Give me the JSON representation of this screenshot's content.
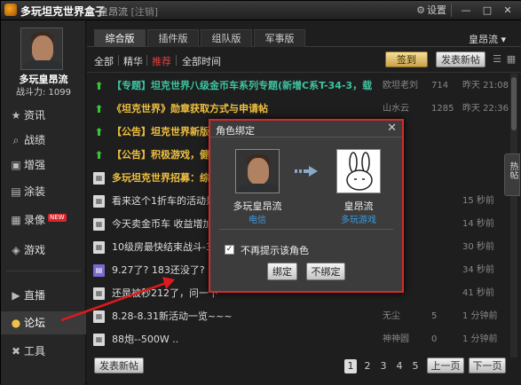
{
  "titlebar": {
    "app_title": "多玩坦克世界盒子",
    "user": "皇昂流",
    "status": "[注销]",
    "settings_label": "设置",
    "minimize": "—",
    "maximize": "□",
    "close": "✕"
  },
  "profile": {
    "username": "多玩皇昂流",
    "power_label": "战斗力: 1099"
  },
  "sidebar": {
    "items": [
      {
        "label": "资讯",
        "icon": "star-icon",
        "glyph": "★"
      },
      {
        "label": "战绩",
        "icon": "search-icon",
        "glyph": "⌕"
      },
      {
        "label": "增强",
        "icon": "box-icon",
        "glyph": "▣"
      },
      {
        "label": "涂装",
        "icon": "paint-icon",
        "glyph": "▤"
      },
      {
        "label": "录像",
        "icon": "video-icon",
        "glyph": "▦",
        "badge": "NEW"
      },
      {
        "label": "游戏",
        "icon": "gamepad-icon",
        "glyph": "◈"
      },
      {
        "label": "直播",
        "icon": "play-icon",
        "glyph": "▶"
      },
      {
        "label": "论坛",
        "icon": "chat-icon",
        "glyph": "●"
      },
      {
        "label": "工具",
        "icon": "wrench-icon",
        "glyph": "✖"
      }
    ]
  },
  "tabs": [
    "综合版",
    "插件版",
    "组队版",
    "军事版"
  ],
  "user_dropdown": "皇昂流 ▾",
  "filters": {
    "all": "全部",
    "essence": "精华",
    "hot": "推荐",
    "all_time": "全部时间"
  },
  "buttons": {
    "checkin": "签到",
    "new_post": "发表新帖",
    "new_post_bottom": "发表新帖",
    "prev_page": "上一页",
    "next_page": "下一页"
  },
  "threads": [
    {
      "icon": "up",
      "title": "【专题】坦克世界八级金币车系列专题(新增C系T-34-3，载",
      "style": "green",
      "author": "欧坦老刘",
      "count": "714",
      "time": "昨天 21:08"
    },
    {
      "icon": "up",
      "title": "《坦克世界》勋章获取方式与申请帖",
      "style": "gold",
      "author": "山水云",
      "count": "1285",
      "time": "昨天 22:36"
    },
    {
      "icon": "up",
      "title": "【公告】坦克世界新版",
      "style": "gold",
      "author": "",
      "count": "",
      "time": ""
    },
    {
      "icon": "up",
      "title": "【公告】积极游戏，健康",
      "style": "gold",
      "author": "",
      "count": "",
      "time": ""
    },
    {
      "icon": "doc",
      "title": "多玩坦克世界招募：综合",
      "style": "gold",
      "author": "",
      "count": "",
      "time": ""
    },
    {
      "icon": "doc",
      "title": "看来这个1折车的活动是不会",
      "style": "",
      "author": "",
      "count": "",
      "time": ""
    },
    {
      "icon": "doc",
      "title": "今天卖金币车 收益增加 1",
      "style": "",
      "author": "",
      "count": "",
      "time": ""
    },
    {
      "icon": "doc",
      "title": "10级房最快结束战斗-3分半",
      "style": "",
      "author": "",
      "count": "",
      "time": ""
    },
    {
      "icon": "vote",
      "title": "9.27了? 183还没了? 该秒还得",
      "style": "",
      "author": "",
      "count": "",
      "time": ""
    },
    {
      "icon": "doc",
      "title": "还是被秒212了，问一下",
      "style": "",
      "author": "",
      "count": "",
      "time": ""
    },
    {
      "icon": "doc",
      "title": "8.28-8.31新活动一览~~~",
      "style": "",
      "author": "无尘",
      "count": "5",
      "time": "1 分钟前"
    },
    {
      "icon": "doc",
      "title": "88炮--500W ..",
      "style": "",
      "author": "神神圆",
      "count": "0",
      "time": "1 分钟前"
    }
  ],
  "side_counts": [
    {
      "author": "",
      "count": "",
      "time": "15 秒前"
    },
    {
      "author": "",
      "count": "",
      "time": "14 秒前"
    },
    {
      "author": "",
      "count": "",
      "time": "30 秒前"
    },
    {
      "author": "",
      "count": "",
      "time": "34 秒前"
    },
    {
      "author": "",
      "count": "",
      "time": "41 秒前"
    }
  ],
  "hot_tab": "热帖",
  "pagination": [
    "1",
    "2",
    "3",
    "4",
    "5"
  ],
  "dialog": {
    "title": "角色绑定",
    "close": "✕",
    "left_name": "多玩皇昂流",
    "left_sub": "电信",
    "right_name": "皇昂流",
    "right_sub": "多玩游戏",
    "checkbox_label": "不再提示该角色",
    "checkbox_mark": "✓",
    "bind": "绑定",
    "unbind": "不绑定"
  },
  "colors": {
    "accent_red": "#d62a2a",
    "highlight_green": "#3cc4a0",
    "highlight_gold": "#f0c040",
    "link_blue": "#3a9ae0"
  }
}
